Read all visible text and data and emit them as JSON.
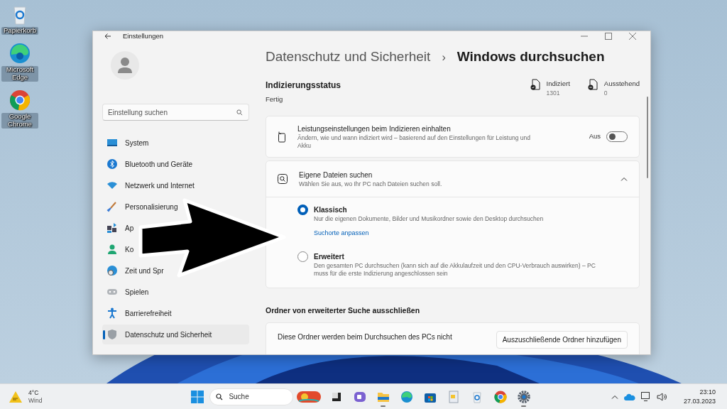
{
  "desktop": {
    "icons": [
      {
        "label": "Papierkorb"
      },
      {
        "label": "Microsoft Edge"
      },
      {
        "label": "Google Chrome"
      }
    ]
  },
  "window": {
    "title": "Einstellungen"
  },
  "sidebar": {
    "search": {
      "placeholder": "Einstellung suchen"
    },
    "items": [
      {
        "label": "System",
        "selected": false
      },
      {
        "label": "Bluetooth und Geräte",
        "selected": false
      },
      {
        "label": "Netzwerk und Internet",
        "selected": false
      },
      {
        "label": "Personalisierung",
        "selected": false
      },
      {
        "label": "Ap",
        "selected": false
      },
      {
        "label": "Ko",
        "selected": false
      },
      {
        "label": "Zeit und Spr",
        "selected": false
      },
      {
        "label": "Spielen",
        "selected": false
      },
      {
        "label": "Barrierefreiheit",
        "selected": false
      },
      {
        "label": "Datenschutz und Sicherheit",
        "selected": true
      }
    ]
  },
  "breadcrumb": {
    "parent": "Datenschutz und Sicherheit",
    "separator": "›",
    "current": "Windows durchsuchen"
  },
  "indexing": {
    "title": "Indizierungsstatus",
    "status": "Fertig",
    "counters": [
      {
        "label": "Indiziert",
        "value": "1301"
      },
      {
        "label": "Ausstehend",
        "value": "0"
      }
    ]
  },
  "performance": {
    "title": "Leistungseinstellungen beim Indizieren einhalten",
    "description": "Ändern, wie und wann indiziert wird – basierend auf den Einstellungen für Leistung und Akku",
    "toggle_label": "Aus",
    "on": false
  },
  "find_files": {
    "title": "Eigene Dateien suchen",
    "description": "Wählen Sie aus, wo Ihr PC nach Dateien suchen soll.",
    "expanded": true,
    "options": [
      {
        "label": "Klassisch",
        "description": "Nur die eigenen Dokumente, Bilder und Musikordner sowie den Desktop durchsuchen",
        "link": "Suchorte anpassen",
        "selected": true
      },
      {
        "label": "Erweitert",
        "description": "Den gesamten PC durchsuchen (kann sich auf die Akkulaufzeit und den CPU-Verbrauch auswirken) – PC muss für die erste Indizierung angeschlossen sein",
        "selected": false
      }
    ]
  },
  "exclude": {
    "heading": "Ordner von erweiterter Suche ausschließen",
    "description": "Diese Ordner werden beim Durchsuchen des PCs nicht",
    "button": "Auszuschließende Ordner hinzufügen"
  },
  "taskbar": {
    "weather": {
      "temperature": "4°C",
      "condition": "Wind"
    },
    "search": {
      "placeholder": "Suche"
    },
    "apps": [
      {
        "kind": "news",
        "running": false
      },
      {
        "kind": "taskview",
        "running": false
      },
      {
        "kind": "chat",
        "running": false
      },
      {
        "kind": "explorer",
        "running": true
      },
      {
        "kind": "edge",
        "running": false
      },
      {
        "kind": "store",
        "running": false
      },
      {
        "kind": "notepad",
        "running": false
      },
      {
        "kind": "recycle",
        "running": false
      },
      {
        "kind": "chrome",
        "running": false
      },
      {
        "kind": "settings",
        "running": true
      }
    ],
    "clock": {
      "time": "23:10",
      "date": "27.03.2023"
    }
  }
}
